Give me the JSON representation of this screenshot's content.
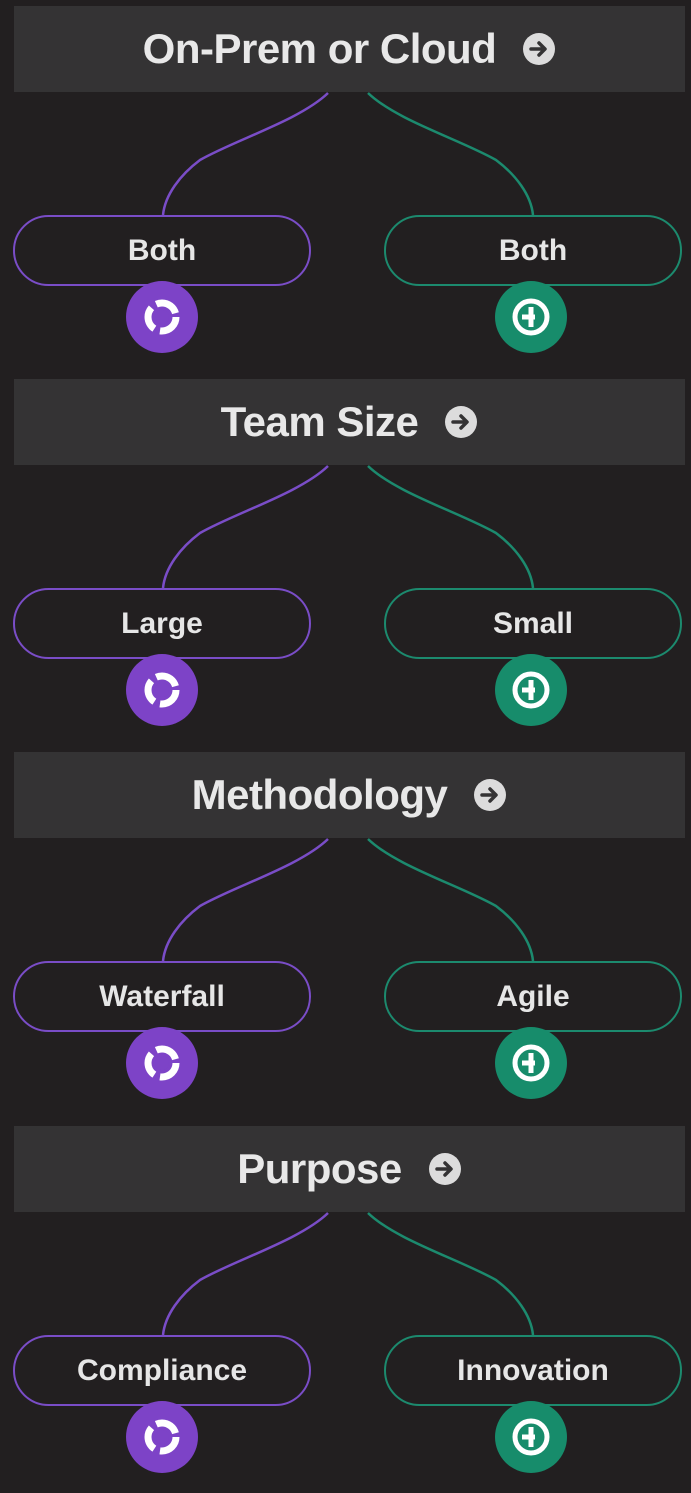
{
  "colors": {
    "background": "#221f20",
    "header_bg": "#343334",
    "purple_accent": "#7d43c7",
    "green_accent": "#178c6b"
  },
  "sections": [
    {
      "title": "On-Prem or Cloud",
      "left_option": "Both",
      "right_option": "Both",
      "left_icon": "purple-cycle-icon",
      "right_icon": "green-split-icon"
    },
    {
      "title": "Team Size",
      "left_option": "Large",
      "right_option": "Small",
      "left_icon": "purple-cycle-icon",
      "right_icon": "green-split-icon"
    },
    {
      "title": "Methodology",
      "left_option": "Waterfall",
      "right_option": "Agile",
      "left_icon": "purple-cycle-icon",
      "right_icon": "green-split-icon"
    },
    {
      "title": "Purpose",
      "left_option": "Compliance",
      "right_option": "Innovation",
      "left_icon": "purple-cycle-icon",
      "right_icon": "green-split-icon"
    }
  ]
}
